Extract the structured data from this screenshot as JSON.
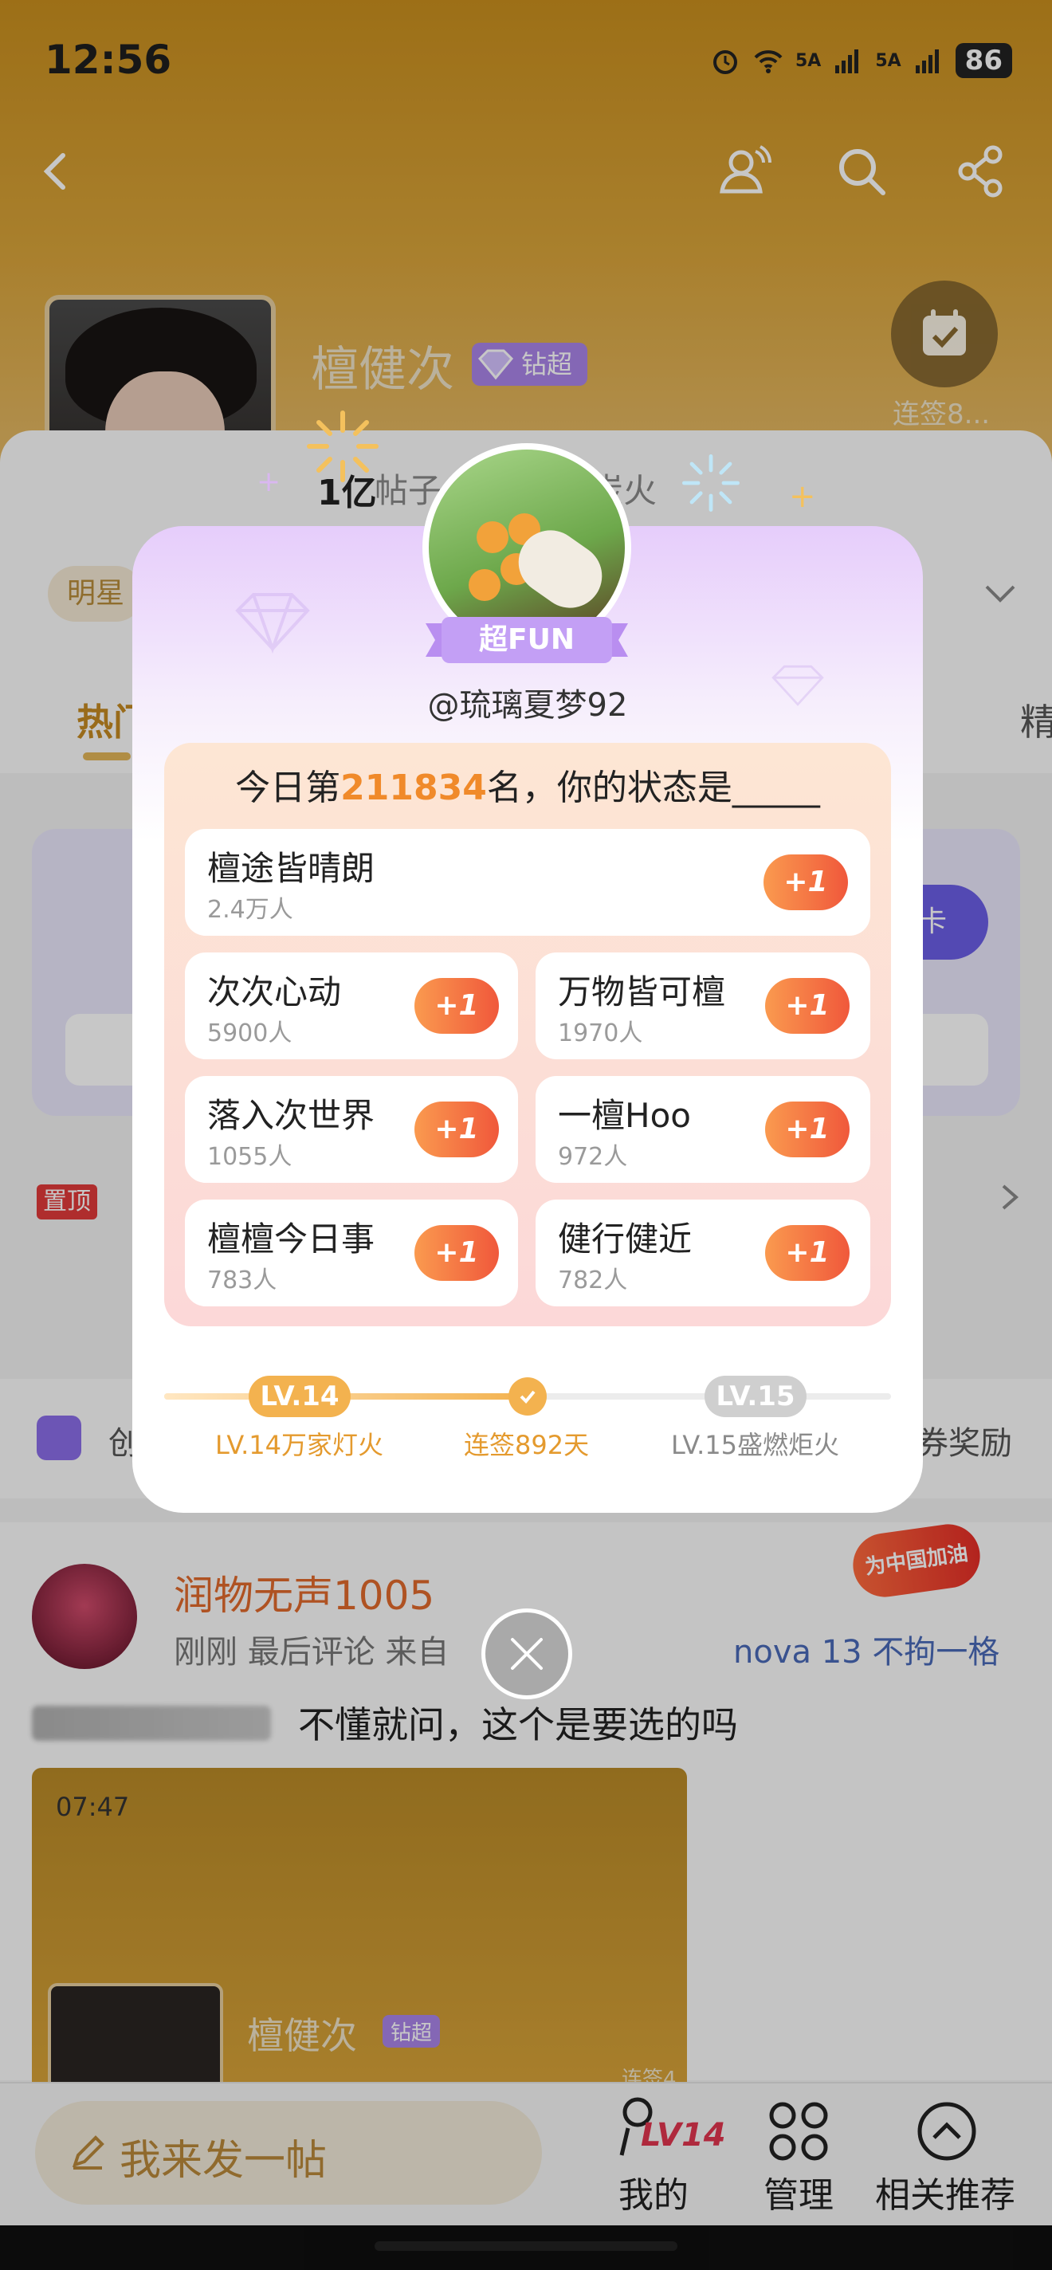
{
  "status_bar": {
    "time": "12:56",
    "signal_1": "5A",
    "signal_2": "5A",
    "battery": "86"
  },
  "header": {
    "name": "檀健次",
    "vip_label": "钻超",
    "checkin_label": "连签8...",
    "stats_num": "1亿",
    "stats_label_1": "帖子",
    "stats_label_2": "炭火",
    "tag_star": "明星",
    "tab_hot": "热门",
    "tab_jing": "精"
  },
  "underlying": {
    "card_button": "卡",
    "pin_tag": "置顶",
    "reward_prefix": "创",
    "reward_text": "券奖励",
    "post": {
      "user": "润物无声1005",
      "meta": "刚刚 最后评论  来自",
      "meta_from": "nova 13 不拘一格",
      "text": "不懂就问，这个是要选的吗",
      "fire_badge": "为中国加油",
      "shot_time": "07:47",
      "shot_name": "檀健次",
      "shot_vip": "钻超",
      "shot_checkin": "连签4"
    }
  },
  "bottom_bar": {
    "compose": "我来发一帖",
    "mine_level": "LV14",
    "mine": "我的",
    "manage": "管理",
    "recommend": "相关推荐"
  },
  "modal": {
    "badge": "超FUN",
    "username": "@琉璃夏梦92",
    "rank_prefix": "今日第",
    "rank_number": "211834",
    "rank_suffix": "名，你的状态是_____",
    "plus_label": "+1",
    "options": [
      {
        "name": "檀途皆晴朗",
        "count": "2.4万人"
      },
      {
        "name": "次次心动",
        "count": "5900人"
      },
      {
        "name": "万物皆可檀",
        "count": "1970人"
      },
      {
        "name": "落入次世界",
        "count": "1055人"
      },
      {
        "name": "一檀Hoo",
        "count": "972人"
      },
      {
        "name": "檀檀今日事",
        "count": "783人"
      },
      {
        "name": "健行健近",
        "count": "782人"
      }
    ],
    "level_current": "LV.14",
    "level_next": "LV.15",
    "level_current_name": "LV.14万家灯火",
    "checkin_days": "连签892天",
    "level_next_name": "LV.15盛燃炬火",
    "progress": 0.5
  },
  "colors": {
    "accent_orange": "#f08a2a",
    "plus_gradient_start": "#fa9a4f",
    "plus_gradient_end": "#f0583b",
    "level_gold": "#f3b24f"
  }
}
